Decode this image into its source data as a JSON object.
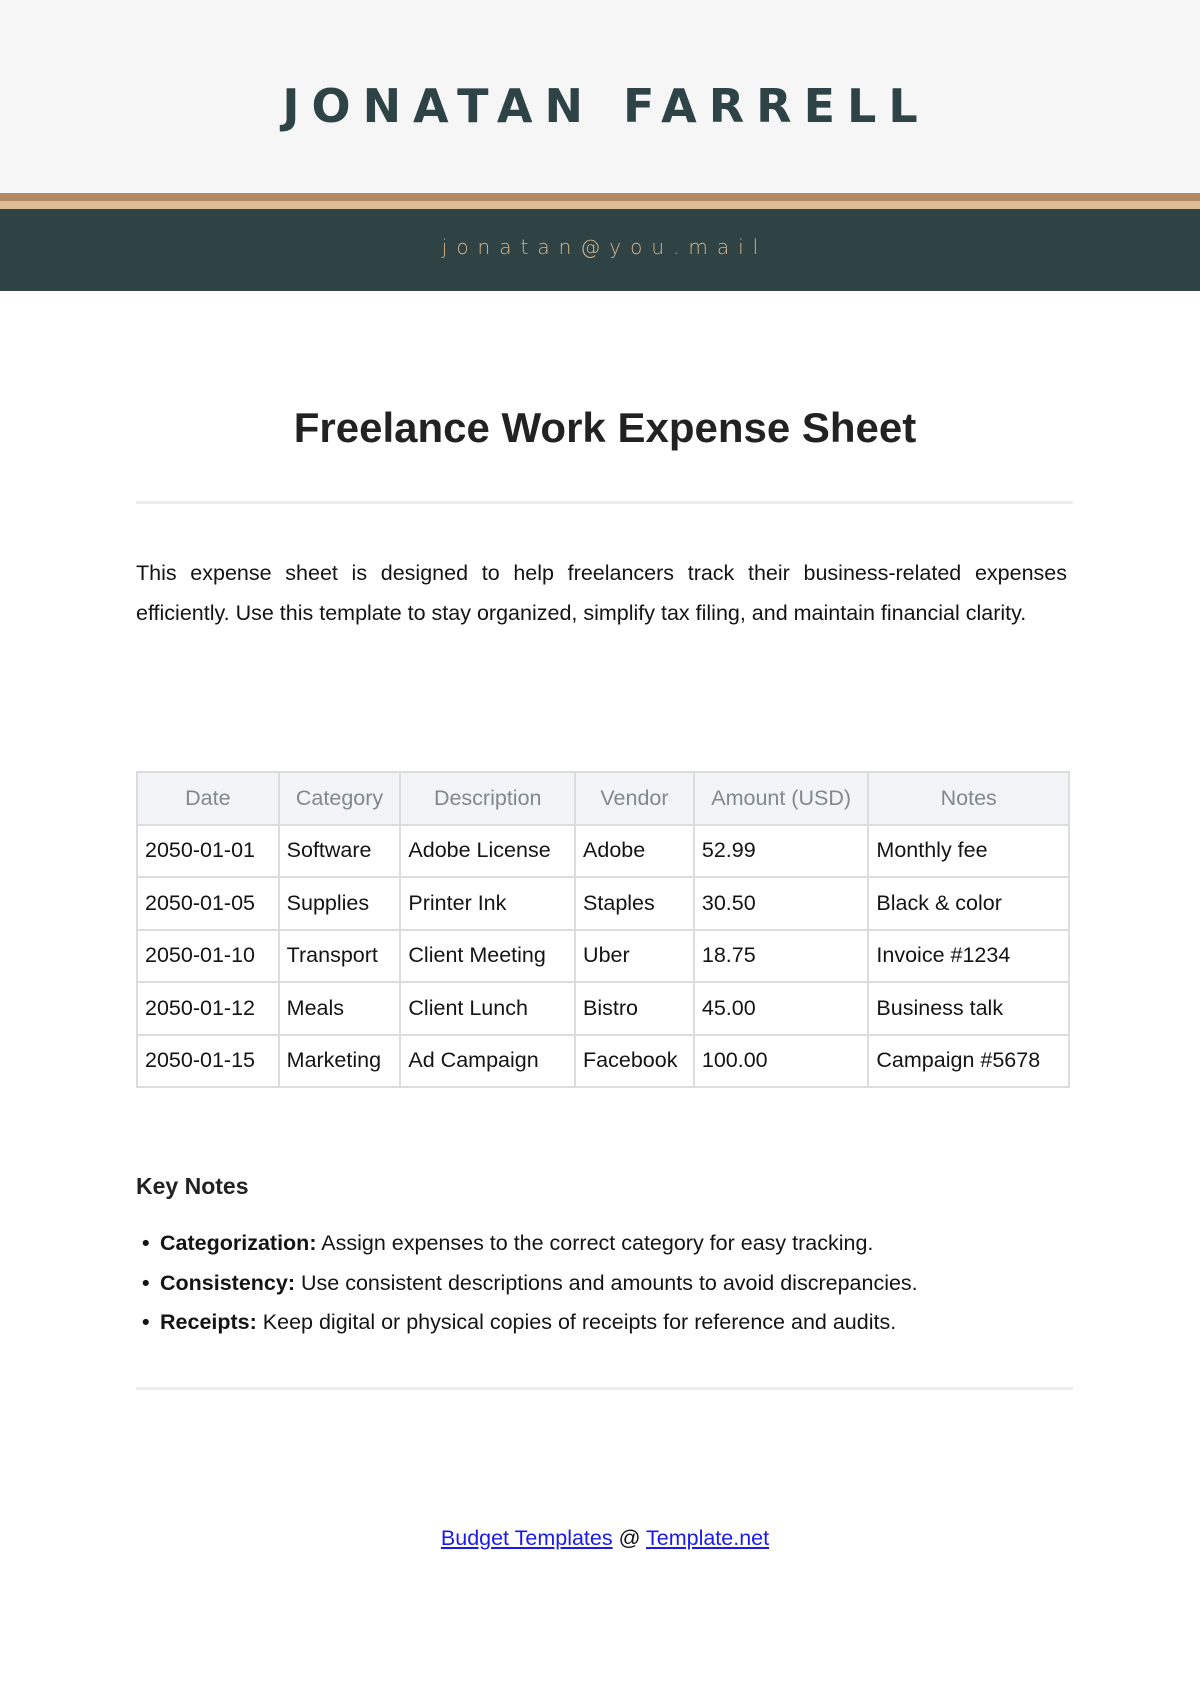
{
  "header": {
    "name": "JONATAN FARRELL",
    "email": "jonatan@you.mail",
    "colors": {
      "top_background": "#f6f6f6",
      "name_text": "#2e4346",
      "stripe_dark": "#b38a64",
      "stripe_light": "#dcbd95",
      "band_background": "#2f4345",
      "email_text": "#d8b58a"
    }
  },
  "document": {
    "title": "Freelance Work Expense Sheet",
    "intro": "This expense sheet is designed to help freelancers track their business-related expenses efficiently. Use this template to stay organized, simplify tax filing, and maintain financial clarity."
  },
  "table": {
    "headers": [
      "Date",
      "Category",
      "Description",
      "Vendor",
      "Amount (USD)",
      "Notes"
    ],
    "rows": [
      [
        "2050-01-01",
        "Software",
        "Adobe License",
        "Adobe",
        "52.99",
        "Monthly fee"
      ],
      [
        "2050-01-05",
        "Supplies",
        "Printer Ink",
        "Staples",
        "30.50",
        "Black & color"
      ],
      [
        "2050-01-10",
        "Transport",
        "Client Meeting",
        "Uber",
        "18.75",
        "Invoice #1234"
      ],
      [
        "2050-01-12",
        "Meals",
        "Client Lunch",
        "Bistro",
        "45.00",
        "Business talk"
      ],
      [
        "2050-01-15",
        "Marketing",
        "Ad Campaign",
        "Facebook",
        "100.00",
        "Campaign #5678"
      ]
    ]
  },
  "key_notes": {
    "title": "Key Notes",
    "bullet": "•",
    "items": [
      {
        "term": "Categorization:",
        "text": " Assign expenses to the correct category for easy tracking."
      },
      {
        "term": "Consistency:",
        "text": " Use consistent descriptions and amounts to avoid discrepancies."
      },
      {
        "term": "Receipts:",
        "text": " Keep digital or physical copies of receipts for reference and audits."
      }
    ]
  },
  "footer": {
    "link1": "Budget Templates",
    "separator": " @ ",
    "link2": "Template.net",
    "link_color": "#1a1aee"
  }
}
